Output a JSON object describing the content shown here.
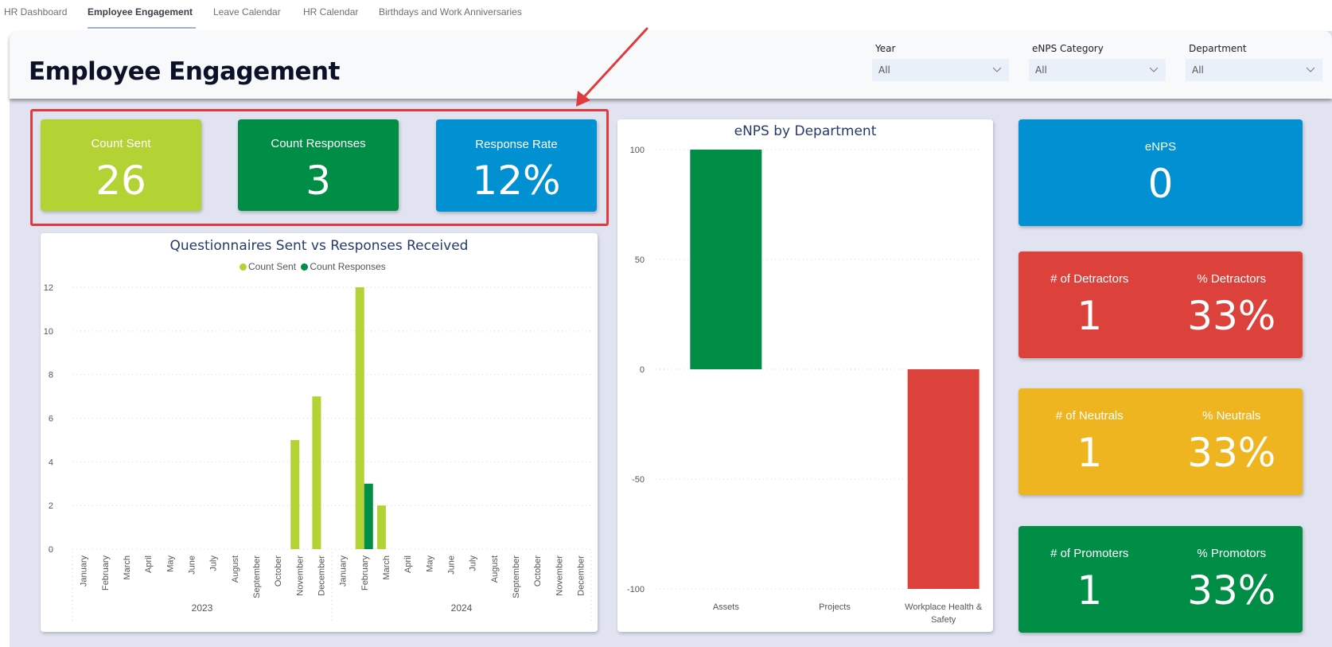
{
  "tabs": [
    {
      "label": "HR Dashboard",
      "active": false
    },
    {
      "label": "Employee Engagement",
      "active": true
    },
    {
      "label": "Leave Calendar",
      "active": false
    },
    {
      "label": "HR Calendar",
      "active": false
    },
    {
      "label": "Birthdays and Work Anniversaries",
      "active": false
    }
  ],
  "header": {
    "title": "Employee Engagement"
  },
  "filters": [
    {
      "label": "Year",
      "value": "All"
    },
    {
      "label": "eNPS Category",
      "value": "All"
    },
    {
      "label": "Department",
      "value": "All"
    }
  ],
  "kpis": {
    "count_sent": {
      "label": "Count Sent",
      "value": "26",
      "color": "#b3d334"
    },
    "count_responses": {
      "label": "Count Responses",
      "value": "3",
      "color": "#008e47"
    },
    "response_rate": {
      "label": "Response Rate",
      "value": "12%",
      "color": "#0191d3"
    },
    "enps": {
      "label": "eNPS",
      "value": "0",
      "color": "#0191d3"
    },
    "detractors": {
      "count_label": "# of Detractors",
      "count": "1",
      "pct_label": "% Detractors",
      "pct": "33%",
      "color": "#dc423b"
    },
    "neutrals": {
      "count_label": "# of Neutrals",
      "count": "1",
      "pct_label": "% Neutrals",
      "pct": "33%",
      "color": "#efb520"
    },
    "promoters": {
      "count_label": "# of Promoters",
      "count": "1",
      "pct_label": "% Promotors",
      "pct": "33%",
      "color": "#008e47"
    }
  },
  "chart_data": [
    {
      "type": "bar",
      "title": "Questionnaires Sent vs Responses Received",
      "legend_position": "top-center",
      "grid": true,
      "ylim": [
        0,
        12
      ],
      "yticks": [
        0,
        2,
        4,
        6,
        8,
        10,
        12
      ],
      "categories": [
        "January",
        "February",
        "March",
        "April",
        "May",
        "June",
        "July",
        "August",
        "September",
        "October",
        "November",
        "December",
        "January",
        "February",
        "March",
        "April",
        "May",
        "June",
        "July",
        "August",
        "September",
        "October",
        "November",
        "December"
      ],
      "groups": [
        {
          "label": "2023",
          "count": 12
        },
        {
          "label": "2024",
          "count": 12
        }
      ],
      "series": [
        {
          "name": "Count Sent",
          "color": "#b3d334",
          "values": [
            0,
            0,
            0,
            0,
            0,
            0,
            0,
            0,
            0,
            0,
            5,
            7,
            0,
            12,
            2,
            0,
            0,
            0,
            0,
            0,
            0,
            0,
            0,
            0
          ]
        },
        {
          "name": "Count Responses",
          "color": "#008e47",
          "values": [
            0,
            0,
            0,
            0,
            0,
            0,
            0,
            0,
            0,
            0,
            0,
            0,
            0,
            3,
            0,
            0,
            0,
            0,
            0,
            0,
            0,
            0,
            0,
            0
          ]
        }
      ]
    },
    {
      "type": "bar",
      "title": "eNPS by Department",
      "grid": true,
      "ylim": [
        -100,
        100
      ],
      "yticks": [
        100,
        50,
        0,
        -50,
        -100
      ],
      "categories": [
        "Assets",
        "Projects",
        "Workplace Health & Safety"
      ],
      "values": [
        100,
        0,
        -100
      ],
      "colors": [
        "#008e47",
        "#b3d334",
        "#dc423b"
      ]
    }
  ]
}
